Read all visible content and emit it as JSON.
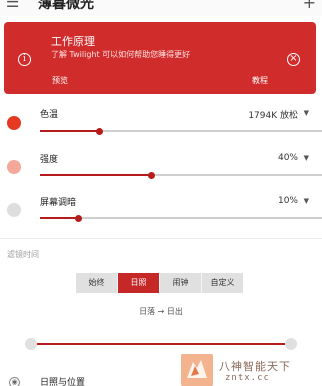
{
  "appbar": {
    "menu_icon": "menu-icon",
    "title": "薄暮微光",
    "add_icon": "add-icon"
  },
  "card": {
    "title": "工作原理",
    "subtitle": "了解 Twilight 可以如何帮助您睡得更好",
    "preview_label": "预览",
    "tutorial_label": "教程",
    "info_icon": "info-icon",
    "close_icon": "close-icon",
    "color": "#d12c2c"
  },
  "settings": {
    "temperature": {
      "label": "色温",
      "value": "1794K 放松",
      "dot_color": "#e53922",
      "level": 0.22
    },
    "intensity": {
      "label": "强度",
      "value": "40%",
      "dot_color": "#f4a89a",
      "level": 0.4
    },
    "dim": {
      "label": "屏幕调暗",
      "value": "10%",
      "dot_color": "#dedede",
      "level": 0.1
    }
  },
  "filter_section": {
    "label": "滤镜时间",
    "tabs": [
      "始终",
      "日照",
      "闹钟",
      "自定义"
    ],
    "active_tab": "日照",
    "route": "日落 → 日出"
  },
  "location_row": {
    "label": "日照与位置",
    "icon": "location-icon"
  },
  "watermark": {
    "text": "八神智能天下",
    "sub": "zntx.cc"
  },
  "colors": {
    "accent": "#c62828",
    "track": "#cfcfcf"
  }
}
